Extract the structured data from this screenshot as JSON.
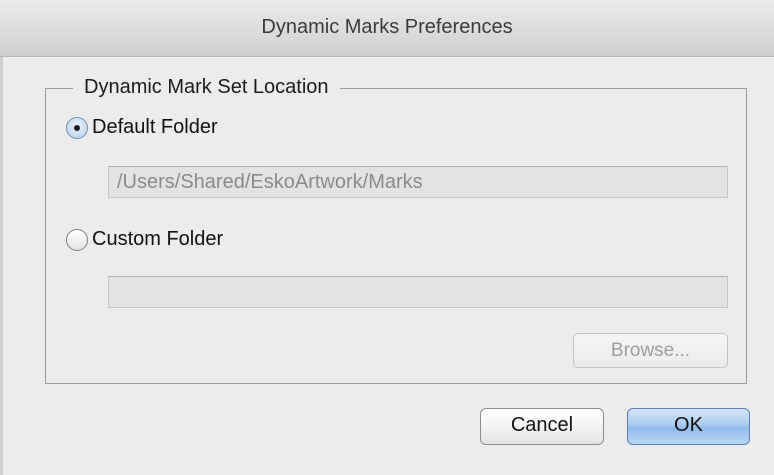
{
  "window": {
    "title": "Dynamic Marks Preferences"
  },
  "group": {
    "title": "Dynamic Mark Set Location"
  },
  "options": {
    "default_folder": {
      "label": "Default Folder",
      "selected": true,
      "path": "/Users/Shared/EskoArtwork/Marks"
    },
    "custom_folder": {
      "label": "Custom Folder",
      "selected": false,
      "path": ""
    }
  },
  "buttons": {
    "browse": "Browse...",
    "cancel": "Cancel",
    "ok": "OK"
  }
}
